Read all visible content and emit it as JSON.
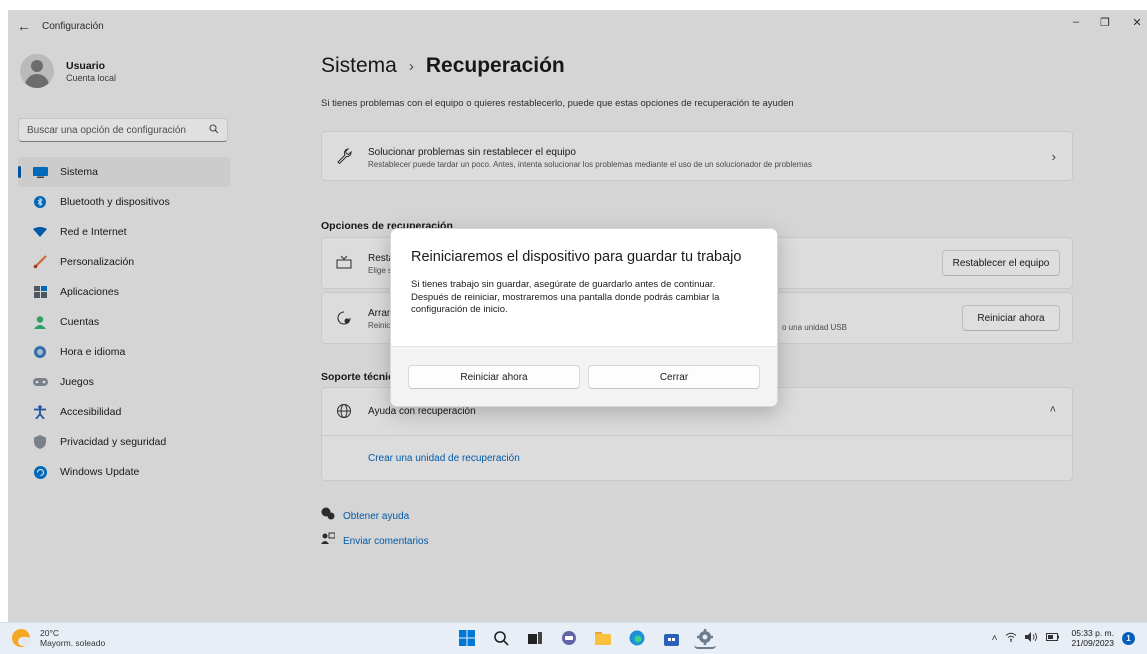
{
  "window": {
    "title": "Configuración",
    "back": "←",
    "minimize": "–",
    "maximize": "❐",
    "close": "✕"
  },
  "sidebar": {
    "user_name": "Usuario",
    "user_sub": "Cuenta local",
    "search_placeholder": "Buscar una opción de configuración",
    "items": [
      {
        "label": "Sistema",
        "icon": "monitor-icon",
        "active": true
      },
      {
        "label": "Bluetooth y dispositivos",
        "icon": "bluetooth-icon"
      },
      {
        "label": "Red e Internet",
        "icon": "wifi-icon"
      },
      {
        "label": "Personalización",
        "icon": "brush-icon"
      },
      {
        "label": "Aplicaciones",
        "icon": "apps-icon"
      },
      {
        "label": "Cuentas",
        "icon": "account-icon"
      },
      {
        "label": "Hora e idioma",
        "icon": "globe-clock-icon"
      },
      {
        "label": "Juegos",
        "icon": "gamepad-icon"
      },
      {
        "label": "Accesibilidad",
        "icon": "accessibility-icon"
      },
      {
        "label": "Privacidad y seguridad",
        "icon": "shield-icon"
      },
      {
        "label": "Windows Update",
        "icon": "update-icon"
      }
    ]
  },
  "main": {
    "breadcrumb_parent": "Sistema",
    "breadcrumb_sep": "›",
    "breadcrumb_current": "Recuperación",
    "subtitle": "Si tienes problemas con el equipo o quieres restablecerlo, puede que estas opciones de recuperación te ayuden",
    "troubleshoot_title": "Solucionar problemas sin restablecer el equipo",
    "troubleshoot_desc": "Restablecer puede tardar un poco. Antes, intenta solucionar los problemas mediante el uso de un solucionador de problemas",
    "recovery_header": "Opciones de recuperación",
    "reset_title": "Resta",
    "reset_desc": "Elige s",
    "reset_button": "Restablecer el equipo",
    "advanced_title": "Arran",
    "advanced_desc": "Reinic",
    "advanced_desc_tail": "o una unidad USB",
    "advanced_button": "Reiniciar ahora",
    "support_header": "Soporte técnic",
    "help_title": "Ayuda con recuperación",
    "help_link": "Crear una unidad de recuperación",
    "get_help": "Obtener ayuda",
    "feedback": "Enviar comentarios"
  },
  "dialog": {
    "title": "Reiniciaremos el dispositivo para guardar tu trabajo",
    "line1": "Si tienes trabajo sin guardar, asegúrate de guardarlo antes de continuar.",
    "line2": "Después de reiniciar, mostraremos una pantalla donde podrás cambiar la configuración de inicio.",
    "primary": "Reiniciar ahora",
    "secondary": "Cerrar"
  },
  "taskbar": {
    "temp": "20°C",
    "weather": "Mayorm. soleado",
    "time": "05:33 p. m.",
    "date": "21/09/2023",
    "notifications": "1",
    "apps": [
      "start-icon",
      "search-icon",
      "task-view-icon",
      "chat-icon",
      "explorer-icon",
      "edge-icon",
      "store-icon",
      "settings-icon"
    ]
  },
  "colors": {
    "accent": "#005fb8",
    "link": "#0067c0"
  }
}
